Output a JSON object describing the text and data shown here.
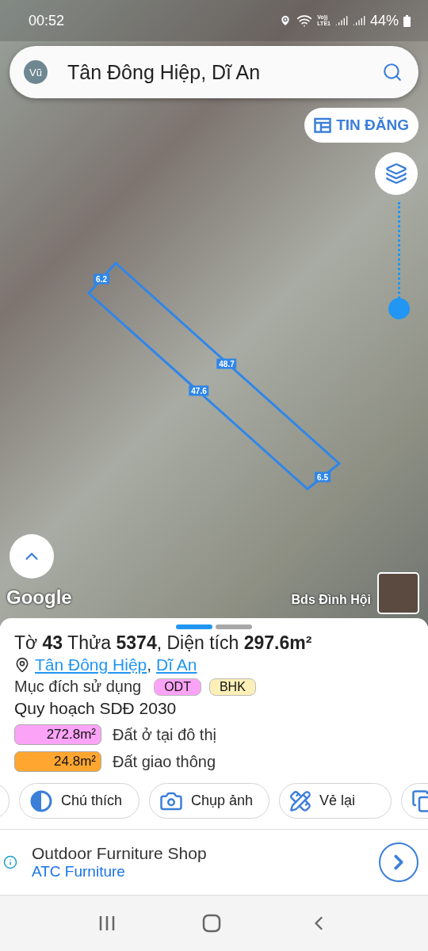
{
  "status_bar": {
    "time": "00:52",
    "network_label": [
      "Vo))",
      "LTE1"
    ],
    "battery": "44%"
  },
  "search": {
    "avatar": "Vũ",
    "value": "Tân Đông Hiệp, Dĩ An"
  },
  "listing_button": {
    "label": "TIN ĐĂNG"
  },
  "map": {
    "edge_labels": [
      "6.2",
      "48.7",
      "47.6",
      "6.5"
    ],
    "brand": "Google",
    "author": "Bds Đình Hội"
  },
  "pages": [
    {
      "selected": true
    },
    {
      "selected": false
    }
  ],
  "parcel": {
    "title": "Tờ **43** Thửa **5374**, Diện tích **297.6m²**",
    "location": {
      "links": [
        "Tân Đông Hiệp",
        "Dĩ An"
      ],
      "separator": ","
    },
    "usage_label": "Mục đích sử dụng",
    "usage_tags": [
      {
        "label": "ODT",
        "color": "#fba4f7"
      },
      {
        "label": "BHK",
        "color": "#fdefb8"
      }
    ],
    "plan_title": "Quy hoạch SDĐ 2030",
    "plan_items": [
      {
        "area": "272.8m²",
        "label": "Đất ở tại đô thị",
        "color": "#fba4f7"
      },
      {
        "area": "24.8m²",
        "label": "Đất giao thông",
        "color": "#ffa630"
      }
    ]
  },
  "actions": [
    {
      "kind": "partial"
    },
    {
      "kind": "legend",
      "label": "Chú thích"
    },
    {
      "kind": "camera",
      "label": "Chụp ảnh"
    },
    {
      "kind": "redraw",
      "label": "Vẻ lại"
    },
    {
      "kind": "copy"
    }
  ],
  "ad": {
    "title": "Outdoor Furniture Shop",
    "advertiser": "ATC Furniture"
  }
}
